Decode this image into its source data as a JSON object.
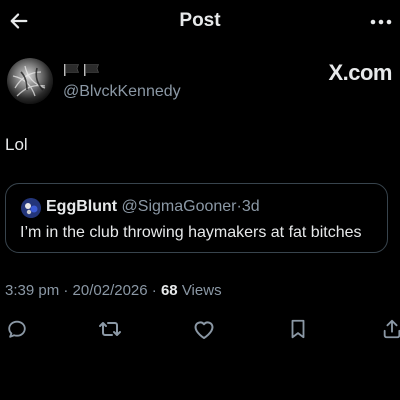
{
  "header": {
    "title": "Post",
    "back_icon": "arrow-left-icon",
    "more_icon": "more-horizontal-icon"
  },
  "post": {
    "display_name_emojis": [
      "black-flag-emoji",
      "black-flag-emoji"
    ],
    "handle": "@BlvckKennedy",
    "source_badge": "X.com",
    "text": "Lol",
    "meta": {
      "time": "3:39 pm",
      "date": "20/02/2026",
      "separator": "·",
      "views_count": "68",
      "views_label": "Views"
    }
  },
  "quote": {
    "name": "EggBlunt",
    "handle": "@SigmaGooner",
    "separator": "·",
    "age": "3d",
    "text": "I’m in the club throwing haymakers at fat bitches"
  },
  "actions": [
    {
      "icon": "reply-icon"
    },
    {
      "icon": "repost-icon"
    },
    {
      "icon": "like-icon"
    },
    {
      "icon": "bookmark-icon"
    },
    {
      "icon": "share-icon"
    }
  ],
  "colors": {
    "background": "#000000",
    "text": "#e7e9ea",
    "secondary_text": "#8b98a5",
    "border": "#38444d"
  }
}
